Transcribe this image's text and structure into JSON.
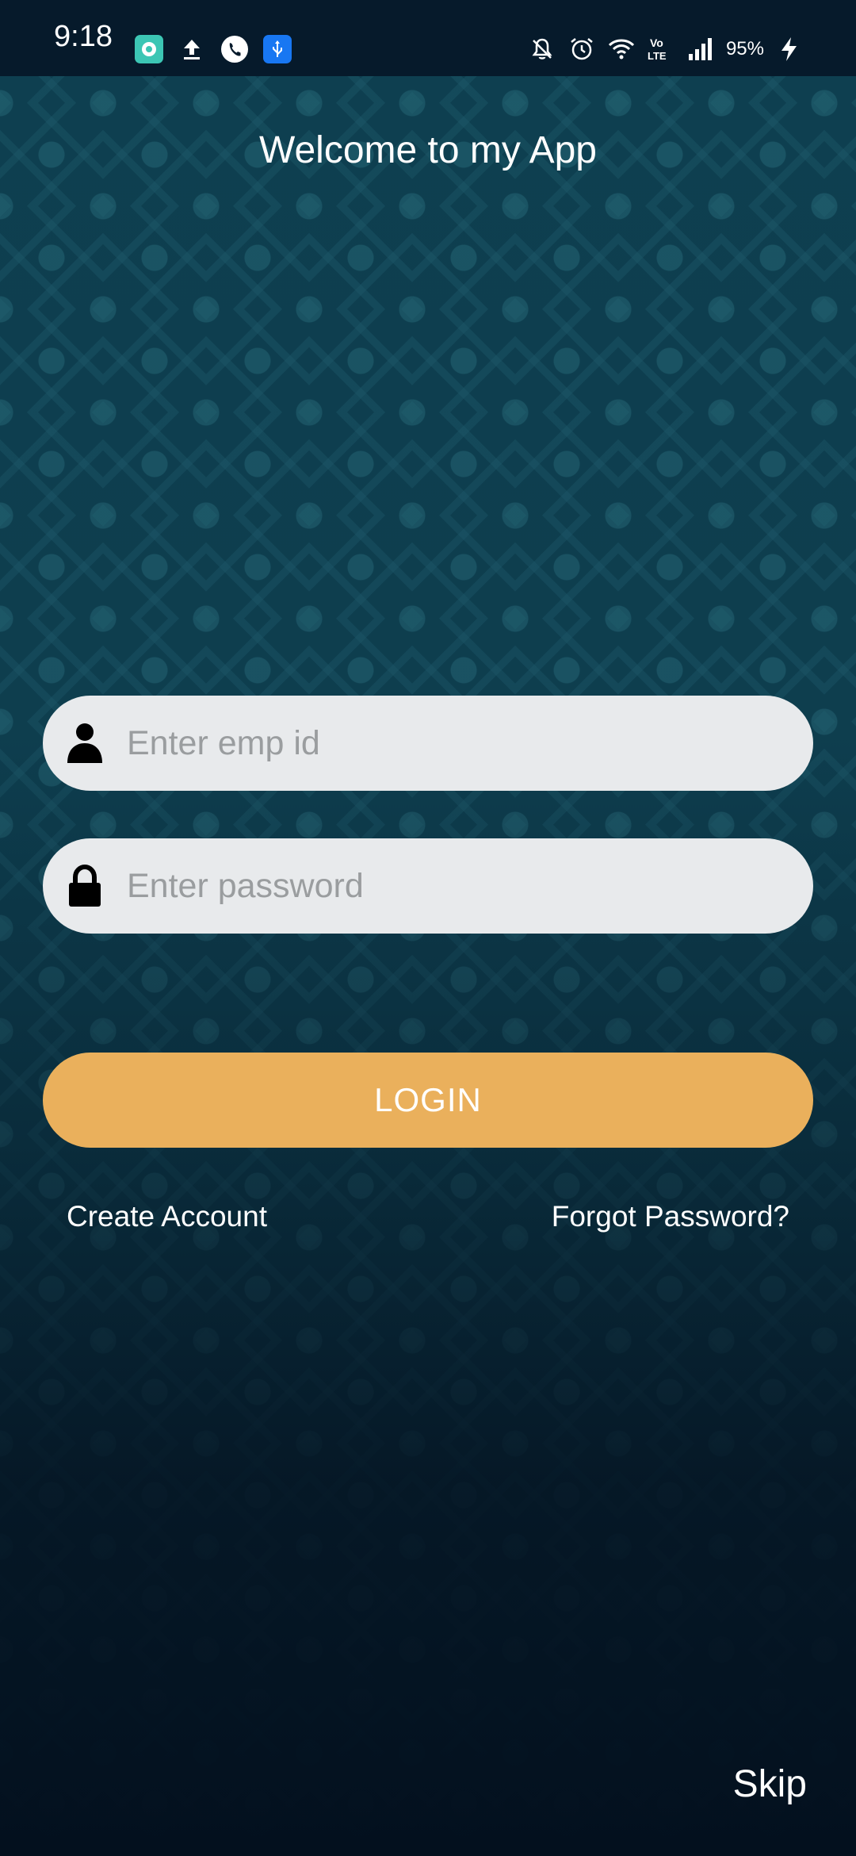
{
  "status_bar": {
    "time": "9:18",
    "left_icons": [
      "app-notification-icon",
      "upload-icon",
      "phone-icon",
      "usb-icon"
    ],
    "right_icons": [
      "bell-off-icon",
      "alarm-icon",
      "wifi-icon",
      "volte-icon",
      "signal-icon",
      "charging-icon"
    ],
    "battery": "95%"
  },
  "header": {
    "title": "Welcome to my App"
  },
  "form": {
    "emp_id": {
      "value": "",
      "placeholder": "Enter emp id",
      "icon": "user-icon"
    },
    "password": {
      "value": "",
      "placeholder": "Enter password",
      "icon": "lock-icon"
    },
    "login_label": "LOGIN",
    "create_account_label": "Create Account",
    "forgot_password_label": "Forgot Password?"
  },
  "footer": {
    "skip_label": "Skip"
  },
  "colors": {
    "status_bar_bg": "#061a2b",
    "background": "#0f4354",
    "field_bg": "#e8eaec",
    "login_bg": "#eab05c",
    "text": "#ffffff"
  }
}
